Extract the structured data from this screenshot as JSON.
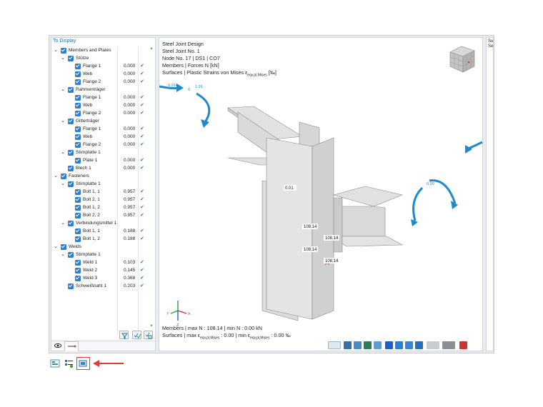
{
  "left_panel": {
    "title": "To Display",
    "tree": [
      {
        "level": 0,
        "chev": "v",
        "label": "Members and Plates",
        "value": "",
        "ok": false
      },
      {
        "level": 1,
        "chev": "v",
        "label": "Stütze",
        "value": "",
        "ok": false
      },
      {
        "level": 2,
        "chev": "",
        "label": "Flange 1",
        "value": "0.000",
        "ok": true
      },
      {
        "level": 2,
        "chev": "",
        "label": "Web",
        "value": "0.000",
        "ok": true
      },
      {
        "level": 2,
        "chev": "",
        "label": "Flange 2",
        "value": "0.000",
        "ok": true
      },
      {
        "level": 1,
        "chev": "v",
        "label": "Rahmenträger",
        "value": "",
        "ok": false
      },
      {
        "level": 2,
        "chev": "",
        "label": "Flange 1",
        "value": "0.000",
        "ok": true
      },
      {
        "level": 2,
        "chev": "",
        "label": "Web",
        "value": "0.000",
        "ok": true
      },
      {
        "level": 2,
        "chev": "",
        "label": "Flange 2",
        "value": "0.000",
        "ok": true
      },
      {
        "level": 1,
        "chev": "v",
        "label": "Gitterträger",
        "value": "",
        "ok": false
      },
      {
        "level": 2,
        "chev": "",
        "label": "Flange 1",
        "value": "0.000",
        "ok": true
      },
      {
        "level": 2,
        "chev": "",
        "label": "Web",
        "value": "0.000",
        "ok": true
      },
      {
        "level": 2,
        "chev": "",
        "label": "Flange 2",
        "value": "0.000",
        "ok": true
      },
      {
        "level": 1,
        "chev": "v",
        "label": "Stirnplatte 1",
        "value": "",
        "ok": false
      },
      {
        "level": 2,
        "chev": "",
        "label": "Plate 1",
        "value": "0.000",
        "ok": true
      },
      {
        "level": 1,
        "chev": "",
        "label": "Blech 1",
        "value": "0.000",
        "ok": true
      },
      {
        "level": 0,
        "chev": "v",
        "label": "Fasteners",
        "value": "",
        "ok": false
      },
      {
        "level": 1,
        "chev": "v",
        "label": "Stirnplatte 1",
        "value": "",
        "ok": false
      },
      {
        "level": 2,
        "chev": "",
        "label": "Bolt 1, 1",
        "value": "0.957",
        "ok": true
      },
      {
        "level": 2,
        "chev": "",
        "label": "Bolt 2, 1",
        "value": "0.957",
        "ok": true
      },
      {
        "level": 2,
        "chev": "",
        "label": "Bolt 1, 2",
        "value": "0.957",
        "ok": true
      },
      {
        "level": 2,
        "chev": "",
        "label": "Bolt 2, 2",
        "value": "0.957",
        "ok": true
      },
      {
        "level": 1,
        "chev": "v",
        "label": "Verbindungsmittel 1",
        "value": "",
        "ok": false
      },
      {
        "level": 2,
        "chev": "",
        "label": "Bolt 1, 1",
        "value": "0.188",
        "ok": true
      },
      {
        "level": 2,
        "chev": "",
        "label": "Bolt 1, 2",
        "value": "0.188",
        "ok": true
      },
      {
        "level": 0,
        "chev": "v",
        "label": "Welds",
        "value": "",
        "ok": false
      },
      {
        "level": 1,
        "chev": "v",
        "label": "Stirnplatte 1",
        "value": "",
        "ok": false
      },
      {
        "level": 2,
        "chev": "",
        "label": "Weld 1",
        "value": "0.103",
        "ok": true
      },
      {
        "level": 2,
        "chev": "",
        "label": "Weld 2",
        "value": "0.145",
        "ok": true
      },
      {
        "level": 2,
        "chev": "",
        "label": "Weld 3",
        "value": "0.368",
        "ok": true
      },
      {
        "level": 1,
        "chev": "",
        "label": "Schweißnaht 1",
        "value": "0.203",
        "ok": true
      }
    ]
  },
  "viewport": {
    "info_lines": [
      "Steel Joint Design",
      "Steel Joint No. 1",
      "Node No. 17 | DS1 | CO7",
      "Members | Forces N [kN]"
    ],
    "surfaces_prefix": "Surfaces | Plastic Strains von Mises ε",
    "surfaces_sub": "eqv,pl,Mises",
    "surfaces_suffix": " [‰]",
    "bottom_line1": "Members | max N : 108.14 | min N : 0.00 kN",
    "bottom_line2_a": "Surfaces | max ε",
    "bottom_line2_sub1": "eqv,pl,Mises",
    "bottom_line2_b": " : 0.00 | min ε",
    "bottom_line2_sub2": "eqv,pl,Mises",
    "bottom_line2_c": " : 0.00 ‰",
    "labels": {
      "l1": "0.01",
      "l2": "108.14",
      "l3": "108.14",
      "l4": "108.14",
      "l5": "108.14",
      "m1": "0.014",
      "m2": "0",
      "m3": "1.91",
      "m4": "0.00",
      "m5": "0"
    },
    "axes": {
      "x": "X",
      "y": "Y",
      "z": "Z"
    }
  },
  "right_strip": {
    "text": "Su\nSe"
  },
  "colors": {
    "accent": "#2f7fd0",
    "check": "#2aa02a",
    "arrow": "#e03a3a",
    "moment": "#1e88d0"
  }
}
